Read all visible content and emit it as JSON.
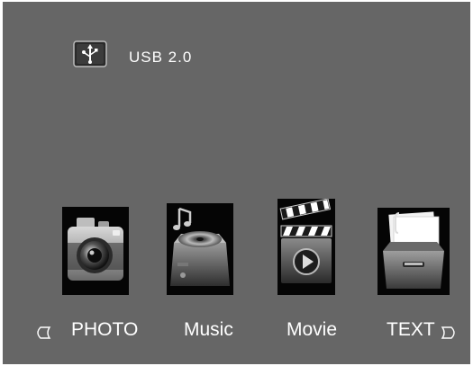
{
  "header": {
    "device_label": "USB 2.0",
    "device_icon": "usb-drive-icon"
  },
  "menu": {
    "items": [
      {
        "label": "PHOTO",
        "icon": "camera-icon"
      },
      {
        "label": "Music",
        "icon": "speaker-disc-icon"
      },
      {
        "label": "Movie",
        "icon": "clapperboard-icon"
      },
      {
        "label": "TEXT",
        "icon": "file-folder-icon"
      }
    ],
    "nav_left_icon": "left-arrow-icon",
    "nav_right_icon": "right-arrow-icon"
  },
  "colors": {
    "background": "#666666",
    "tile_background": "#050505",
    "text": "#ffffff"
  }
}
